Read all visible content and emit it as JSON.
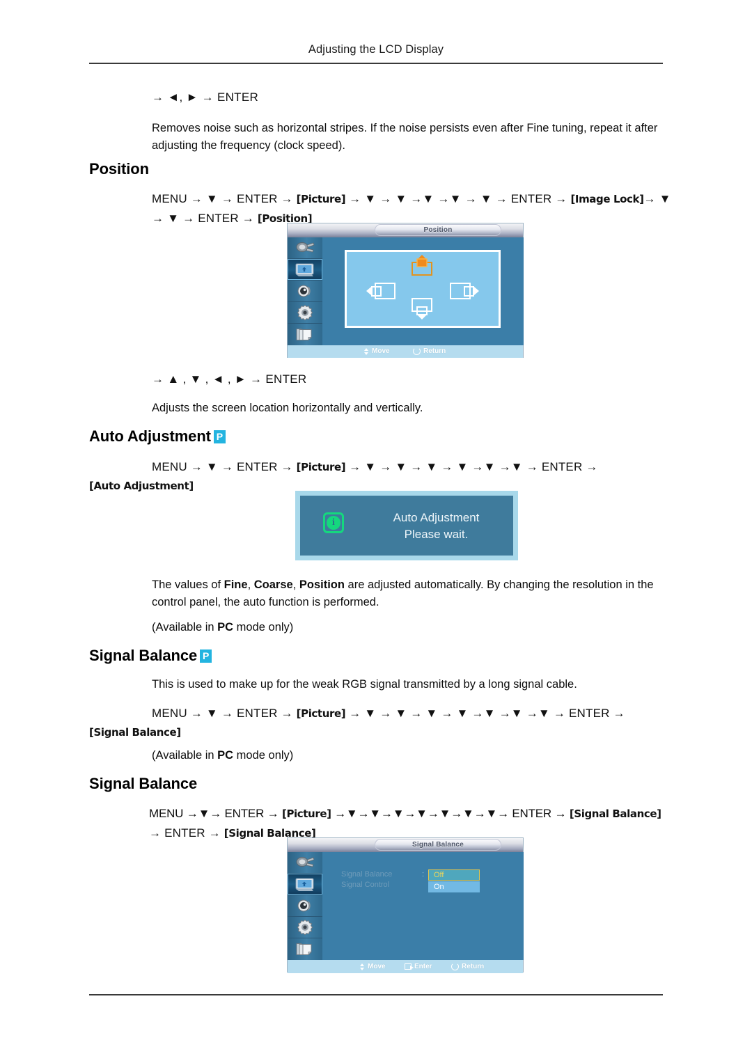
{
  "header": {
    "title": "Adjusting the LCD Display"
  },
  "intro": {
    "keys": "→ ◄, ► → ENTER",
    "paragraph": "Removes noise such as horizontal stripes. If the noise persists even after Fine tuning, repeat it after adjusting the frequency (clock speed)."
  },
  "sections": {
    "position": {
      "heading": "Position",
      "path_line1_prefix": "MENU → ▼ → ENTER → ",
      "path_line1_tok1": "[Picture]",
      "path_line1_mid": " → ▼ → ▼ →▼ →▼ → ▼ → ENTER → ",
      "path_line1_tok2": "[Image Lock]",
      "path_line1_suffix": "→ ▼",
      "path_line2_prefix": "→ ▼ → ENTER → ",
      "path_line2_tok": "[Position]",
      "keys": "→ ▲ , ▼ , ◄ , ► → ENTER",
      "description": "Adjusts the screen location horizontally and vertically."
    },
    "auto_adjustment": {
      "heading": "Auto Adjustment",
      "badge": "P",
      "path_line1_prefix": "MENU  →  ▼  →  ENTER  →  ",
      "path_line1_tok1": "[Picture]",
      "path_line1_mid": "  →  ▼  →  ▼  →  ▼  →  ▼  →▼  →▼  →  ENTER  →",
      "path_line2_tok": "[Auto Adjustment]",
      "paragraph_pre": "The values of ",
      "paragraph_b1": "Fine",
      "paragraph_s1": ", ",
      "paragraph_b2": "Coarse",
      "paragraph_s2": ", ",
      "paragraph_b3": "Position",
      "paragraph_post": " are adjusted automatically. By changing the resolution in the control panel, the auto function is performed.",
      "available_pre": "(Available in ",
      "available_bold": "PC",
      "available_post": " mode only)"
    },
    "signal_balance_p": {
      "heading": "Signal Balance",
      "badge": "P",
      "description": "This is used to make up for the weak RGB signal transmitted by a long signal cable.",
      "path_line1_prefix": "MENU  →  ▼  →  ENTER  →  ",
      "path_line1_tok1": "[Picture]",
      "path_line1_mid": "  →  ▼  →  ▼  →  ▼  →  ▼  →▼  →▼  →▼  →  ENTER  →",
      "path_line2_tok": "[Signal Balance]",
      "available_pre": "(Available in ",
      "available_bold": "PC",
      "available_post": " mode only)"
    },
    "signal_balance": {
      "heading": "Signal Balance",
      "path_line1_prefix": "MENU →▼→ ENTER → ",
      "path_line1_tok1": "[Picture]",
      "path_line1_mid": " →▼→▼→▼→▼→▼→▼→▼→ ENTER → ",
      "path_line1_tok2": "[Signal Balance]",
      "path_line2_prefix": "→ ENTER → ",
      "path_line2_tok": "[Signal Balance]"
    }
  },
  "osd_position": {
    "title": "Position",
    "sidebar_icons": [
      "input-plug-icon",
      "picture-icon",
      "sound-speaker-icon",
      "setup-gear-icon",
      "multi-control-icon"
    ],
    "active_index": 1,
    "direction_icons": [
      "move-up-selected-icon",
      "move-left-icon",
      "move-right-icon",
      "move-down-icon"
    ],
    "footer": [
      {
        "icon": "updown-arrows-icon",
        "label": "Move"
      },
      {
        "icon": "return-icon",
        "label": "Return"
      }
    ]
  },
  "osd_auto": {
    "icon": "info-icon",
    "line1": "Auto Adjustment",
    "line2": "Please wait."
  },
  "osd_signal": {
    "title": "Signal Balance",
    "sidebar_icons": [
      "input-plug-icon",
      "picture-icon",
      "sound-speaker-icon",
      "setup-gear-icon",
      "multi-control-icon"
    ],
    "active_index": 1,
    "rows": [
      {
        "label": "Signal Balance",
        "colon": ":",
        "value": "Off"
      },
      {
        "label": "Signal Control",
        "colon": "",
        "value": "On"
      }
    ],
    "footer": [
      {
        "icon": "updown-arrows-icon",
        "label": "Move"
      },
      {
        "icon": "enter-icon",
        "label": "Enter"
      },
      {
        "icon": "return-icon",
        "label": "Return"
      }
    ]
  },
  "colors": {
    "badge": "#23b4e0",
    "osd_bg": "#3b7ea8",
    "osd_screen": "#85c8ec",
    "osd_footer": "#b5dcef",
    "selected_border": "#e2c64e",
    "selected_text": "#f0d757",
    "alt_row": "#72b9e4",
    "info_green": "#15d87e",
    "accent_orange": "#f08a1c"
  }
}
